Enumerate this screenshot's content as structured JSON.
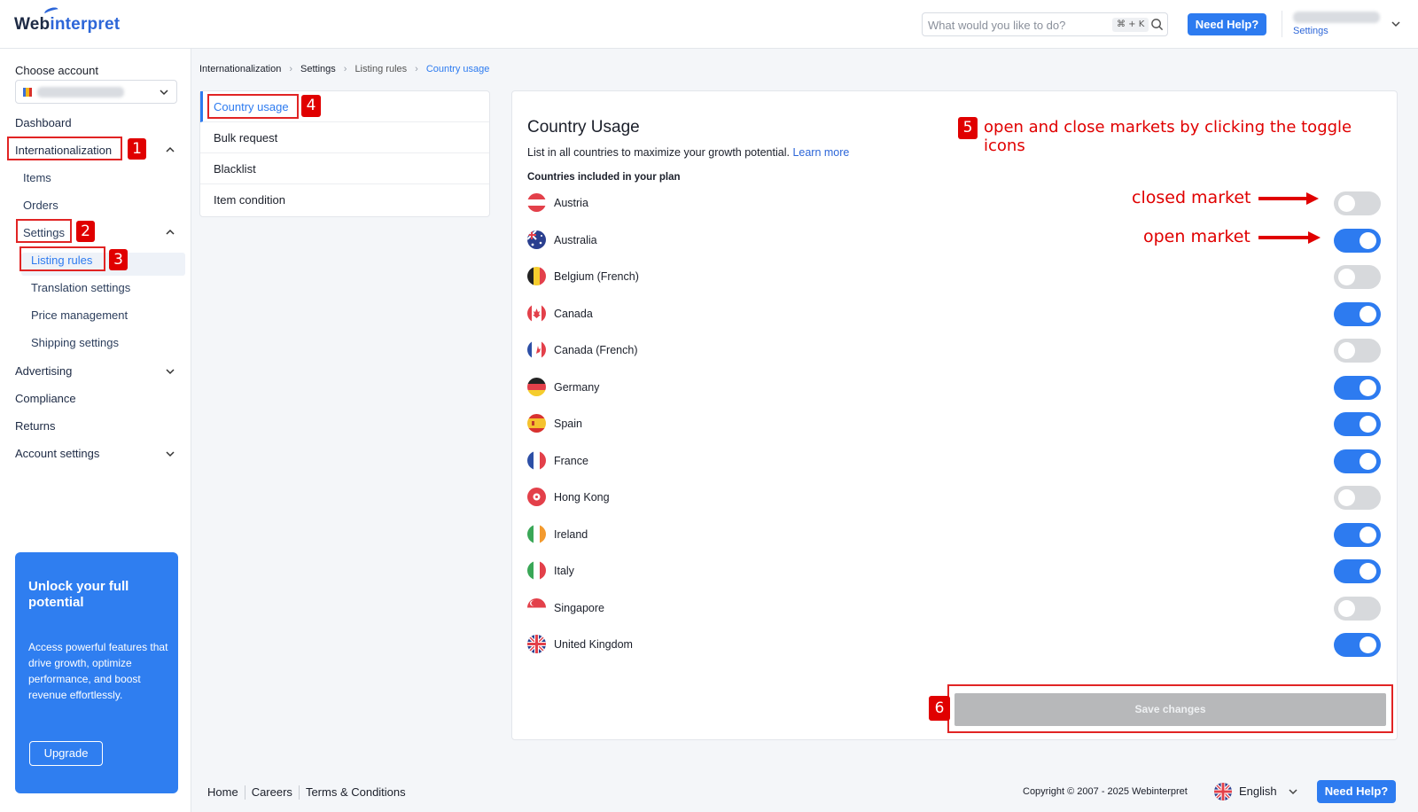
{
  "app": {
    "logo_prefix": "Web",
    "logo_suffix": "interpret"
  },
  "search": {
    "placeholder": "What would you like to do?",
    "shortcut": "⌘ + K"
  },
  "header": {
    "need_help": "Need Help?",
    "user_link": "Settings"
  },
  "sidebar": {
    "choose_account": "Choose account",
    "items": {
      "dashboard": "Dashboard",
      "internationalization": "Internationalization",
      "items": "Items",
      "orders": "Orders",
      "settings": "Settings",
      "listing_rules": "Listing rules",
      "translation_settings": "Translation settings",
      "price_management": "Price management",
      "shipping_settings": "Shipping settings",
      "advertising": "Advertising",
      "compliance": "Compliance",
      "returns": "Returns",
      "account_settings": "Account settings"
    },
    "promo": {
      "title": "Unlock your full potential",
      "body": "Access powerful features that drive growth, optimize performance, and boost revenue effortlessly.",
      "button": "Upgrade"
    }
  },
  "breadcrumb": [
    "Internationalization",
    "Settings",
    "Listing rules",
    "Country usage"
  ],
  "submenu": [
    "Country usage",
    "Bulk request",
    "Blacklist",
    "Item condition"
  ],
  "main": {
    "title": "Country Usage",
    "description": "List in all countries to maximize your growth potential.",
    "learn_more": "Learn more",
    "countries_label": "Countries included in your plan",
    "countries": [
      {
        "name": "Austria",
        "enabled": false
      },
      {
        "name": "Australia",
        "enabled": true
      },
      {
        "name": "Belgium (French)",
        "enabled": false
      },
      {
        "name": "Canada",
        "enabled": true
      },
      {
        "name": "Canada (French)",
        "enabled": false
      },
      {
        "name": "Germany",
        "enabled": true
      },
      {
        "name": "Spain",
        "enabled": true
      },
      {
        "name": "France",
        "enabled": true
      },
      {
        "name": "Hong Kong",
        "enabled": false
      },
      {
        "name": "Ireland",
        "enabled": true
      },
      {
        "name": "Italy",
        "enabled": true
      },
      {
        "name": "Singapore",
        "enabled": false
      },
      {
        "name": "United Kingdom",
        "enabled": true
      }
    ],
    "save_button": "Save changes"
  },
  "annotations": {
    "numbers": [
      "1",
      "2",
      "3",
      "4",
      "5",
      "6"
    ],
    "instruction": "open and close markets by clicking the toggle icons",
    "closed_market": "closed market",
    "open_market": "open market"
  },
  "footer": {
    "links": [
      "Home",
      "Careers",
      "Terms & Conditions"
    ],
    "copyright": "Copyright © 2007 - 2025 Webinterpret",
    "language": "English",
    "need_help": "Need Help?"
  },
  "colors": {
    "accent": "#2d7bf0",
    "annotation": "#e00000",
    "toggle_off": "#d7d9dc"
  }
}
